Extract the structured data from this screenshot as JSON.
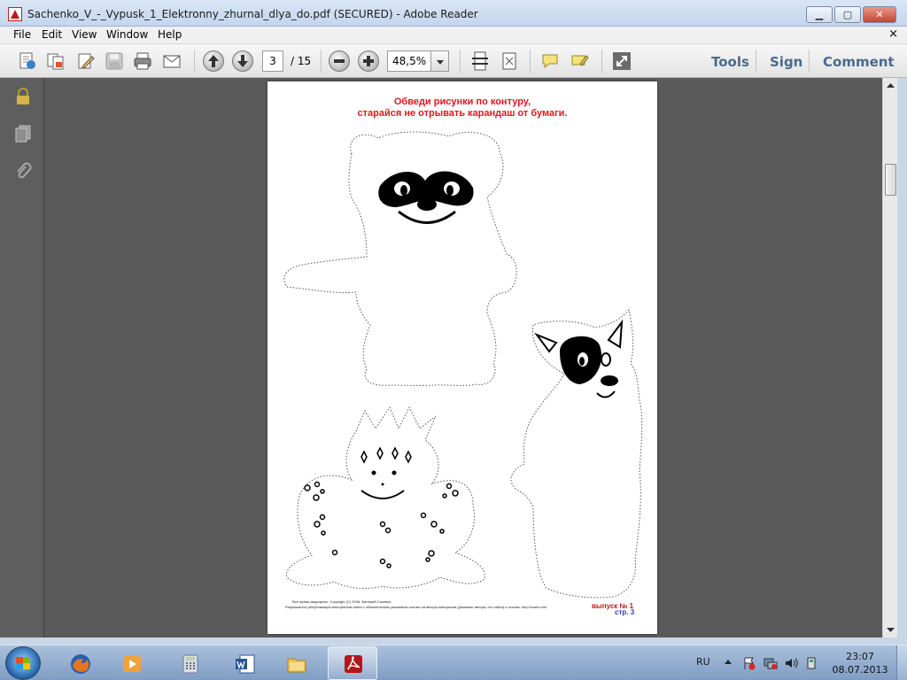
{
  "window": {
    "title": "Sachenko_V_-_Vypusk_1_Elektronny_zhurnal_dlya_do.pdf (SECURED) - Adobe Reader",
    "controls": {
      "minimize": "▁",
      "maximize": "▢",
      "close": "✕"
    }
  },
  "menubar": {
    "items": [
      {
        "label": "File"
      },
      {
        "label": "Edit"
      },
      {
        "label": "View"
      },
      {
        "label": "Window"
      },
      {
        "label": "Help"
      }
    ],
    "close_doc": "×"
  },
  "toolbar": {
    "current_page": "3",
    "page_total": "/ 15",
    "zoom": "48,5%",
    "tools_label": "Tools",
    "sign_label": "Sign",
    "comment_label": "Comment"
  },
  "page": {
    "instruction_line1": "Обведи рисунки по контуру,",
    "instruction_line2": "старайся не отрывать карандаш от бумаги.",
    "copyright_line1": "Все права защищены. Copyright (C) 2008, Валерий Саченко.",
    "copyright_line2": "Разрешается републикация материалов сайта с обязательным указанием ссылки на автора материала (указание автора, его сайта) и ссылки: http://vosko.info",
    "issue_label": "выпуск № 1",
    "page_label": "стр. 3"
  },
  "taskbar": {
    "apps": [
      {
        "name": "firefox"
      },
      {
        "name": "media-player"
      },
      {
        "name": "calculator"
      },
      {
        "name": "word"
      },
      {
        "name": "file-explorer"
      },
      {
        "name": "adobe-reader"
      }
    ],
    "language": "RU",
    "time": "23:07",
    "date": "08.07.2013"
  },
  "colors": {
    "instruction_red": "#e3151c",
    "page_number_blue": "#3a34b8",
    "reader_panel_text": "#4b6a8c"
  }
}
